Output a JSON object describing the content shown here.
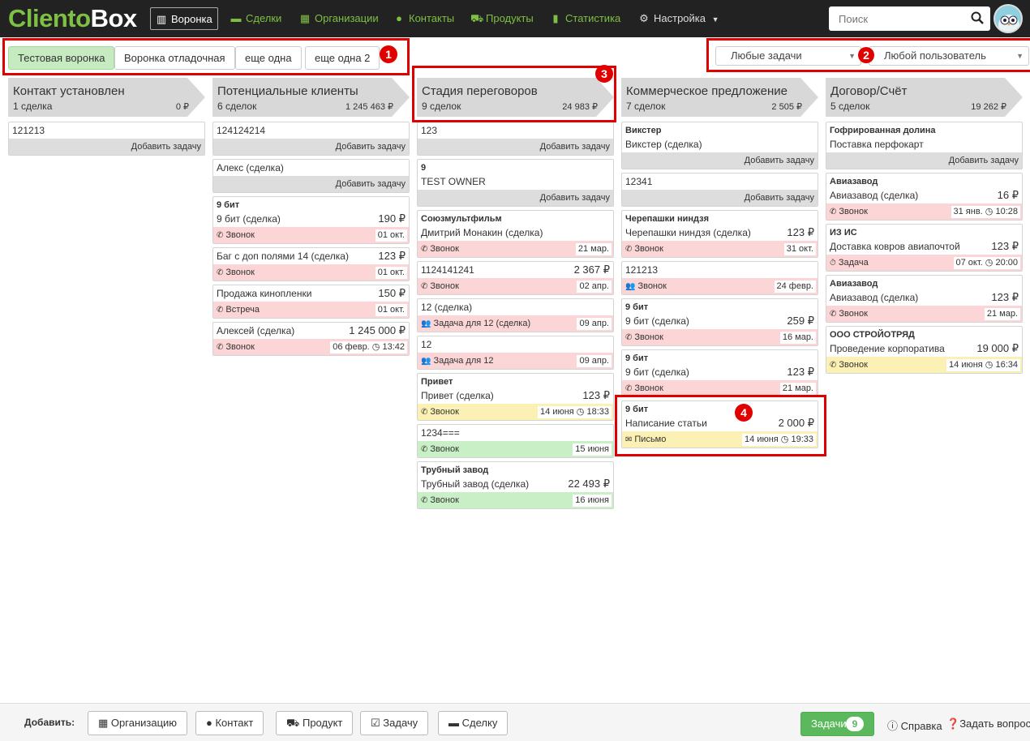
{
  "nav": {
    "logo_part1": "Cliento",
    "logo_part2": "Box",
    "items": [
      {
        "label": "Воронка",
        "icon": "funnel-icon",
        "glyph": "▥"
      },
      {
        "label": "Сделки",
        "icon": "briefcase-icon",
        "glyph": "▬"
      },
      {
        "label": "Организации",
        "icon": "building-icon",
        "glyph": "▦"
      },
      {
        "label": "Контакты",
        "icon": "user-icon",
        "glyph": "●"
      },
      {
        "label": "Продукты",
        "icon": "cart-icon",
        "glyph": "⛟"
      },
      {
        "label": "Статистика",
        "icon": "bar-chart-icon",
        "glyph": "▮"
      },
      {
        "label": "Настройка",
        "icon": "gears-icon",
        "glyph": "⚙"
      }
    ],
    "search_placeholder": "Поиск"
  },
  "funnels": {
    "tabs": [
      "Тестовая воронка",
      "Воронка отладочная",
      "еще одна",
      "еще одна 2"
    ],
    "active": 0
  },
  "filters": {
    "tasks": "Любые задачи",
    "user": "Любой пользователь"
  },
  "markers": [
    "1",
    "2",
    "3",
    "4"
  ],
  "columns": [
    {
      "title": "Контакт установлен",
      "count": "1 сделка",
      "sum": "0 ₽",
      "cards": [
        {
          "lines": [
            "121213"
          ],
          "footer": {
            "type": "add",
            "text": "Добавить задачу"
          }
        }
      ]
    },
    {
      "title": "Потенциальные клиенты",
      "count": "6 сделок",
      "sum": "1 245 463 ₽",
      "cards": [
        {
          "lines": [
            "124124214"
          ],
          "footer": {
            "type": "add",
            "text": "Добавить задачу"
          }
        },
        {
          "lines": [
            "Алекс (сделка)"
          ],
          "footer": {
            "type": "add",
            "text": "Добавить задачу"
          }
        },
        {
          "bold": "9 бит",
          "lines": [
            "9 бит (сделка)"
          ],
          "amount": "190 ₽",
          "footer": {
            "type": "task",
            "color": "pink",
            "kind": "phone",
            "text": "Звонок",
            "date": "01 окт."
          }
        },
        {
          "lines": [
            "Баг с доп полями 14 (сделка)"
          ],
          "amount": "123 ₽",
          "footer": {
            "type": "task",
            "color": "pink",
            "kind": "phone",
            "text": "Звонок",
            "date": "01 окт."
          }
        },
        {
          "lines": [
            "Продажа кинопленки"
          ],
          "amount": "150 ₽",
          "footer": {
            "type": "task",
            "color": "pink",
            "kind": "phone",
            "text": "Встреча",
            "date": "01 окт."
          }
        },
        {
          "lines": [
            "Алексей (сделка)"
          ],
          "amount": "1 245 000 ₽",
          "footer": {
            "type": "task",
            "color": "pink",
            "kind": "phone",
            "text": "Звонок",
            "date": "06 февр.",
            "time": "13:42"
          }
        }
      ]
    },
    {
      "title": "Стадия переговоров",
      "count": "9 сделок",
      "sum": "24 983 ₽",
      "cards": [
        {
          "lines": [
            "123"
          ],
          "footer": {
            "type": "add",
            "text": "Добавить задачу"
          }
        },
        {
          "bold": "9",
          "lines": [
            "TEST OWNER"
          ],
          "footer": {
            "type": "add",
            "text": "Добавить задачу"
          }
        },
        {
          "bold": "Союзмультфильм",
          "lines": [
            "Дмитрий Монакин (сделка)"
          ],
          "footer": {
            "type": "task",
            "color": "pink",
            "kind": "phone",
            "text": "Звонок",
            "date": "21 мар."
          }
        },
        {
          "lines": [
            "1124141241"
          ],
          "amount": "2 367 ₽",
          "footer": {
            "type": "task",
            "color": "pink",
            "kind": "phone",
            "text": "Звонок",
            "date": "02 апр."
          }
        },
        {
          "lines": [
            "12 (сделка)"
          ],
          "footer": {
            "type": "task",
            "color": "pink",
            "kind": "group",
            "text": "Задача для 12 (сделка)",
            "date": "09 апр."
          }
        },
        {
          "lines": [
            "12"
          ],
          "footer": {
            "type": "task",
            "color": "pink",
            "kind": "group",
            "text": "Задача для 12",
            "date": "09 апр."
          }
        },
        {
          "bold": "Привет",
          "lines": [
            "Привет (сделка)"
          ],
          "amount": "123 ₽",
          "footer": {
            "type": "task",
            "color": "yellow",
            "kind": "phone",
            "text": "Звонок",
            "date": "14 июня",
            "time": "18:33"
          }
        },
        {
          "lines": [
            "1234==="
          ],
          "footer": {
            "type": "task",
            "color": "green",
            "kind": "phone",
            "text": "Звонок",
            "date": "15 июня"
          }
        },
        {
          "bold": "Трубный завод",
          "lines": [
            "Трубный завод (сделка)"
          ],
          "amount": "22 493 ₽",
          "footer": {
            "type": "task",
            "color": "green",
            "kind": "phone",
            "text": "Звонок",
            "date": "16 июня"
          }
        }
      ]
    },
    {
      "title": "Коммерческое предложение",
      "count": "7 сделок",
      "sum": "2 505 ₽",
      "cards": [
        {
          "bold": "Викстер",
          "lines": [
            "Викстер (сделка)"
          ],
          "footer": {
            "type": "add",
            "text": "Добавить задачу"
          }
        },
        {
          "lines": [
            "12341"
          ],
          "footer": {
            "type": "add",
            "text": "Добавить задачу"
          }
        },
        {
          "bold": "Черепашки ниндзя",
          "lines": [
            "Черепашки ниндзя (сделка)"
          ],
          "amount": "123 ₽",
          "footer": {
            "type": "task",
            "color": "pink",
            "kind": "phone",
            "text": "Звонок",
            "date": "31 окт."
          }
        },
        {
          "lines": [
            "121213"
          ],
          "footer": {
            "type": "task",
            "color": "pink",
            "kind": "group",
            "text": "Звонок",
            "date": "24 февр."
          }
        },
        {
          "bold": "9 бит",
          "lines": [
            "9 бит (сделка)"
          ],
          "amount": "259 ₽",
          "footer": {
            "type": "task",
            "color": "pink",
            "kind": "phone",
            "text": "Звонок",
            "date": "16 мар."
          }
        },
        {
          "bold": "9 бит",
          "lines": [
            "9 бит (сделка)"
          ],
          "amount": "123 ₽",
          "footer": {
            "type": "task",
            "color": "pink",
            "kind": "phone",
            "text": "Звонок",
            "date": "21 мар."
          }
        },
        {
          "bold": "9 бит",
          "lines": [
            "Написание статьи"
          ],
          "amount": "2 000 ₽",
          "footer": {
            "type": "task",
            "color": "yellow",
            "kind": "mail",
            "text": "Письмо",
            "date": "14 июня",
            "time": "19:33"
          }
        }
      ]
    },
    {
      "title": "Договор/Счёт",
      "count": "5 сделок",
      "sum": "19 262 ₽",
      "cards": [
        {
          "bold": "Гофрированная долина",
          "lines": [
            "Поставка перфокарт"
          ],
          "footer": {
            "type": "add",
            "text": "Добавить задачу"
          }
        },
        {
          "bold": "Авиазавод",
          "lines": [
            "Авиазавод (сделка)"
          ],
          "amount": "16 ₽",
          "footer": {
            "type": "task",
            "color": "pink",
            "kind": "phone",
            "text": "Звонок",
            "date": "31 янв.",
            "time": "10:28"
          }
        },
        {
          "bold": "ИЗ ИС",
          "lines": [
            "Доставка ковров авиапочтой"
          ],
          "amount": "123 ₽",
          "footer": {
            "type": "task",
            "color": "pink",
            "kind": "clock",
            "text": "Задача",
            "date": "07 окт.",
            "time": "20:00"
          }
        },
        {
          "bold": "Авиазавод",
          "lines": [
            "Авиазавод (сделка)"
          ],
          "amount": "123 ₽",
          "footer": {
            "type": "task",
            "color": "pink",
            "kind": "phone",
            "text": "Звонок",
            "date": "21 мар."
          }
        },
        {
          "bold": "ООО СТРОЙОТРЯД",
          "lines": [
            "Проведение корпоратива"
          ],
          "amount": "19 000 ₽",
          "footer": {
            "type": "task",
            "color": "yellow",
            "kind": "phone",
            "text": "Звонок",
            "date": "14 июня",
            "time": "16:34"
          }
        }
      ]
    }
  ],
  "bottom": {
    "add_label": "Добавить:",
    "buttons": [
      {
        "label": "Организацию",
        "icon": "building-icon",
        "glyph": "▦"
      },
      {
        "label": "Контакт",
        "icon": "user-icon",
        "glyph": "●"
      },
      {
        "label": "Продукт",
        "icon": "cart-icon",
        "glyph": "⛟"
      },
      {
        "label": "Задачу",
        "icon": "check-square-icon",
        "glyph": "☑"
      },
      {
        "label": "Сделку",
        "icon": "briefcase-icon",
        "glyph": "▬"
      }
    ],
    "tasks_label": "Задачи",
    "tasks_count": "9",
    "help_label": "Справка",
    "ask_label": "Задать вопрос"
  }
}
